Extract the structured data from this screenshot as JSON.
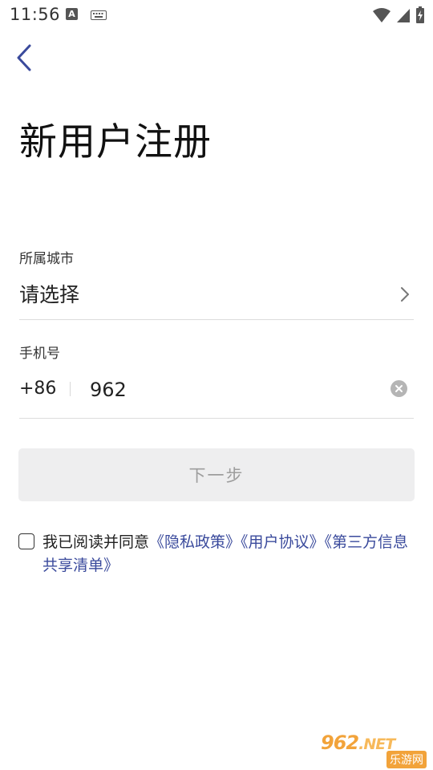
{
  "status_bar": {
    "time": "11:56",
    "a_badge": "A"
  },
  "page_title": "新用户注册",
  "city": {
    "label": "所属城市",
    "value": "请选择"
  },
  "phone": {
    "label": "手机号",
    "country_code": "+86",
    "value": "962"
  },
  "next_button_label": "下一步",
  "agreement": {
    "prefix": "我已阅读并同意",
    "links": [
      "《隐私政策》",
      "《用户协议》",
      "《第三方信息共享清单》"
    ]
  },
  "watermark": {
    "top": "962",
    "top_suffix": ".NET",
    "bottom": "乐游网"
  },
  "colors": {
    "accent": "#3a4a9c",
    "button_bg": "#eeeeef",
    "button_text": "#9d9d9d",
    "divider": "#dcdcdc"
  }
}
